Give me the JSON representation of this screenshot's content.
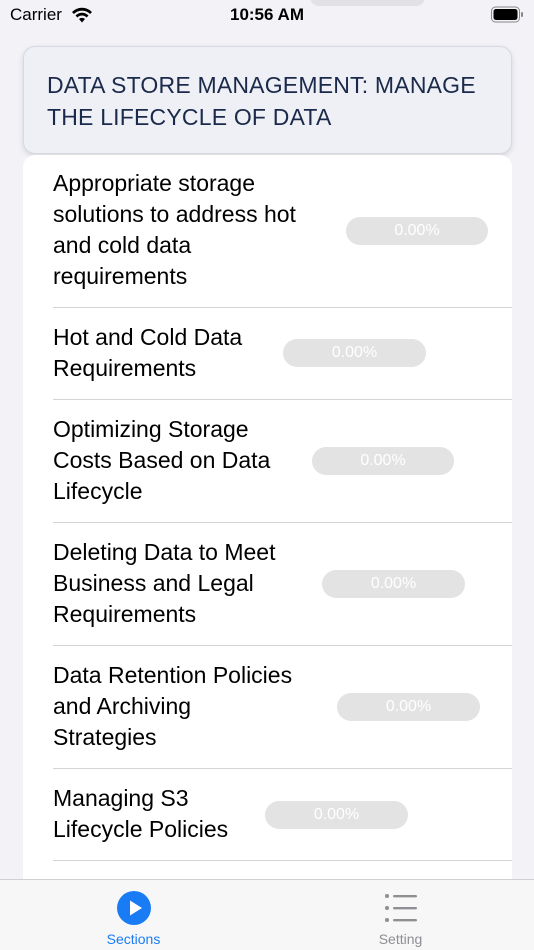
{
  "status_bar": {
    "carrier": "Carrier",
    "time": "10:56 AM"
  },
  "header": {
    "title_line1": "DATA STORE MANAGEMENT: MANAGE",
    "title_line2": "THE LIFECYCLE OF DATA"
  },
  "sections": [
    {
      "title_lines": [
        "Appropriate storage",
        "solutions to address hot",
        "and cold data",
        "requirements"
      ],
      "progress": "0.00%"
    },
    {
      "title_lines": [
        "Hot and Cold Data",
        "Requirements"
      ],
      "progress": "0.00%"
    },
    {
      "title_lines": [
        "Optimizing Storage",
        "Costs Based on Data",
        "Lifecycle"
      ],
      "progress": "0.00%"
    },
    {
      "title_lines": [
        "Deleting Data to Meet",
        "Business and Legal",
        "Requirements"
      ],
      "progress": "0.00%"
    },
    {
      "title_lines": [
        "Data Retention Policies",
        "and Archiving",
        "Strategies"
      ],
      "progress": "0.00%"
    },
    {
      "title_lines": [
        "Managing S3",
        "Lifecycle Policies"
      ],
      "progress": "0.00%"
    }
  ],
  "tab_bar": {
    "sections_label": "Sections",
    "settings_label": "Setting",
    "accent_color": "#1a7cf5",
    "inactive_color": "#8e8e93",
    "sections_icon": "play-circle-icon",
    "settings_icon": "list-icon"
  }
}
